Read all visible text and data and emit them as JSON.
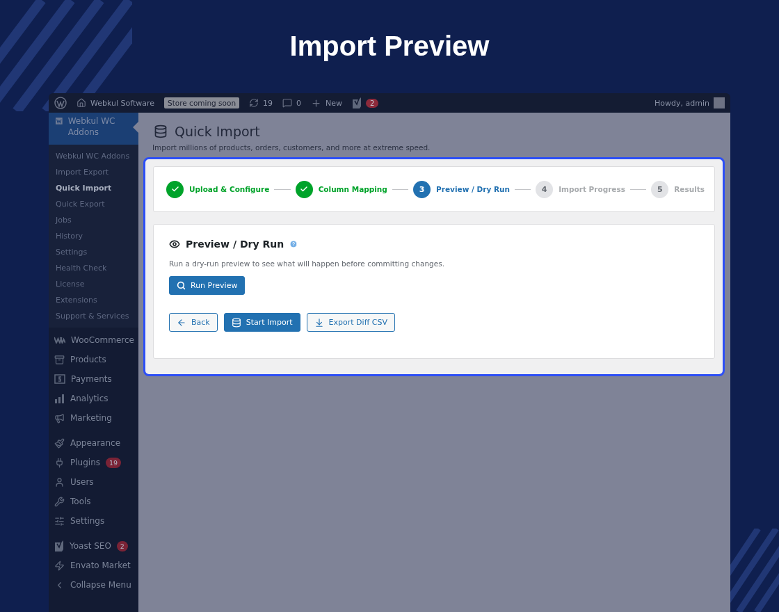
{
  "page_title": "Import Preview",
  "admin_bar": {
    "site_name": "Webkul Software",
    "store_badge": "Store coming soon",
    "updates_count": "19",
    "comments_count": "0",
    "new_label": "New",
    "seo_badge": "2",
    "greeting": "Howdy, admin"
  },
  "sidebar": {
    "current_menu": "Webkul WC Addons",
    "submenu": [
      {
        "label": "Webkul WC Addons",
        "selected": false
      },
      {
        "label": "Import Export",
        "selected": false
      },
      {
        "label": "Quick Import",
        "selected": true
      },
      {
        "label": "Quick Export",
        "selected": false
      },
      {
        "label": "Jobs",
        "selected": false
      },
      {
        "label": "History",
        "selected": false
      },
      {
        "label": "Settings",
        "selected": false
      },
      {
        "label": "Health Check",
        "selected": false
      },
      {
        "label": "License",
        "selected": false
      },
      {
        "label": "Extensions",
        "selected": false
      },
      {
        "label": "Support & Services",
        "selected": false
      }
    ],
    "groups": [
      [
        {
          "label": "WooCommerce"
        },
        {
          "label": "Products"
        },
        {
          "label": "Payments"
        },
        {
          "label": "Analytics"
        },
        {
          "label": "Marketing"
        }
      ],
      [
        {
          "label": "Appearance"
        },
        {
          "label": "Plugins",
          "badge": "19"
        },
        {
          "label": "Users"
        },
        {
          "label": "Tools"
        },
        {
          "label": "Settings"
        }
      ],
      [
        {
          "label": "Yoast SEO",
          "badge": "2"
        },
        {
          "label": "Envato Market"
        },
        {
          "label": "Collapse Menu"
        }
      ]
    ]
  },
  "header": {
    "title": "Quick Import",
    "subtitle": "Import millions of products, orders, customers, and more at extreme speed."
  },
  "steps": [
    {
      "label": "Upload & Configure",
      "kind": "done"
    },
    {
      "label": "Column Mapping",
      "kind": "done"
    },
    {
      "number": "3",
      "label": "Preview / Dry Run",
      "kind": "current"
    },
    {
      "number": "4",
      "label": "Import Progress",
      "kind": "pending"
    },
    {
      "number": "5",
      "label": "Results",
      "kind": "pending"
    }
  ],
  "panel": {
    "title": "Preview / Dry Run",
    "description": "Run a dry-run preview to see what will happen before committing changes.",
    "run_button": "Run Preview",
    "actions": [
      {
        "label": "Back",
        "kind": "secondary"
      },
      {
        "label": "Start Import",
        "kind": "primary"
      },
      {
        "label": "Export Diff CSV",
        "kind": "secondary"
      }
    ]
  }
}
